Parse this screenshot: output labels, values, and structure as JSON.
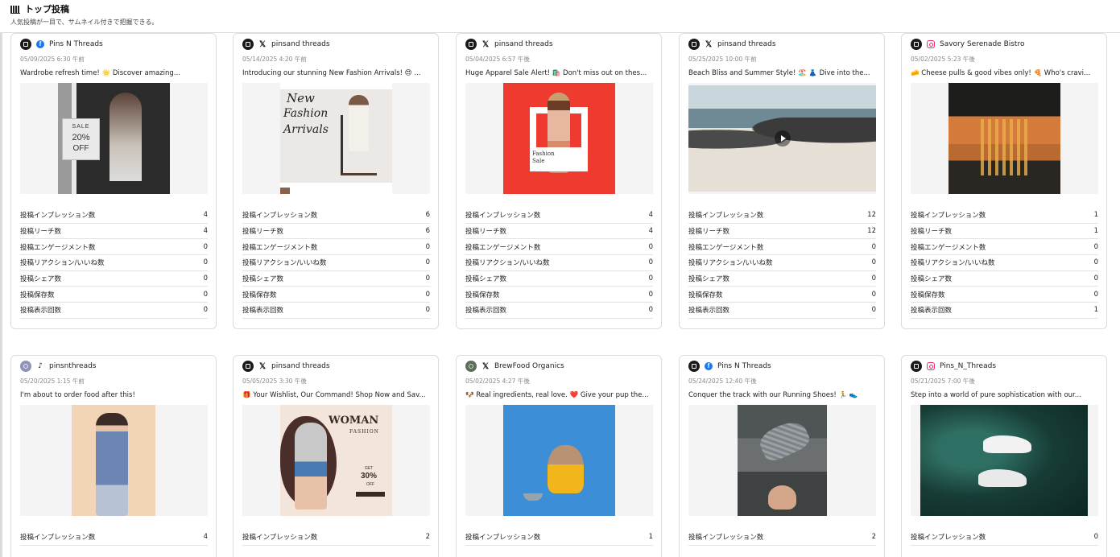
{
  "header": {
    "title": "トップ投稿",
    "subtitle": "人気投稿が一目で、サムネイル付きで把握できる。",
    "icon": "bar-chart-icon"
  },
  "metric_labels": [
    "投稿インプレッション数",
    "投稿リーチ数",
    "投稿エンゲージメント数",
    "投稿リアクション/いいね数",
    "投稿シェア数",
    "投稿保存数",
    "投稿表示回数"
  ],
  "posts": [
    {
      "account": "Pins N Threads",
      "network": "facebook",
      "date": "05/09/2025 6:30 午前",
      "text": "Wardrobe refresh time! 🌟 Discover amazing...",
      "metrics": [
        "4",
        "4",
        "0",
        "0",
        "0",
        "0",
        "0"
      ]
    },
    {
      "account": "pinsand threads",
      "network": "x",
      "date": "05/14/2025 4:20 午前",
      "text": "Introducing our stunning New Fashion Arrivals! 😍 ...",
      "metrics": [
        "6",
        "6",
        "0",
        "0",
        "0",
        "0",
        "0"
      ]
    },
    {
      "account": "pinsand threads",
      "network": "x",
      "date": "05/04/2025 6:57 午後",
      "text": "Huge Apparel Sale Alert! 🛍️ Don't miss out on thes...",
      "metrics": [
        "4",
        "4",
        "0",
        "0",
        "0",
        "0",
        "0"
      ]
    },
    {
      "account": "pinsand threads",
      "network": "x",
      "date": "05/25/2025 10:00 午前",
      "text": "Beach Bliss and Summer Style! 🏖️ 👗 Dive into the...",
      "metrics": [
        "12",
        "12",
        "0",
        "0",
        "0",
        "0",
        "0"
      ]
    },
    {
      "account": "Savory Serenade Bistro",
      "network": "instagram",
      "date": "05/02/2025 5:23 午後",
      "text": "🧀 Cheese pulls & good vibes only! 🍕 Who's cravi...",
      "metrics": [
        "1",
        "1",
        "0",
        "0",
        "0",
        "0",
        "1"
      ]
    },
    {
      "account": "pinsnthreads",
      "network": "tiktok",
      "date": "05/20/2025 1:15 午前",
      "text": "I'm about to order food after this!",
      "metrics": [
        "4"
      ]
    },
    {
      "account": "pinsand threads",
      "network": "x",
      "date": "05/05/2025 3:30 午後",
      "text": "🎁 Your Wishlist, Our Command! Shop Now and Sav...",
      "metrics": [
        "2"
      ]
    },
    {
      "account": "BrewFood Organics",
      "network": "x",
      "date": "05/02/2025 4:27 午後",
      "text": "🐶 Real ingredients, real love. ❤️ Give your pup the...",
      "metrics": [
        "1"
      ]
    },
    {
      "account": "Pins N Threads",
      "network": "facebook",
      "date": "05/24/2025 12:40 午後",
      "text": "Conquer the track with our Running Shoes! 🏃 👟",
      "metrics": [
        "2"
      ]
    },
    {
      "account": "Pins_N_Threads",
      "network": "instagram",
      "date": "05/21/2025 7:00 午後",
      "text": "Step into a world of pure sophistication with our...",
      "metrics": [
        "0"
      ]
    }
  ],
  "thumbnails": [
    {
      "desc": "sale",
      "sale_line1": "SALE",
      "sale_line2": "20%",
      "sale_line3": "OFF"
    },
    {
      "desc": "new-fashion",
      "line1": "New",
      "line2": "Fashion",
      "line3": "Arrivals"
    },
    {
      "desc": "fashion-sale",
      "line1": "Fashion",
      "line2": "Sale"
    },
    {
      "desc": "beach-video"
    },
    {
      "desc": "cheese-pizza"
    },
    {
      "desc": "pastel-model"
    },
    {
      "desc": "woman-fashion",
      "line1": "WOMAN",
      "line2": "FASHION",
      "line3": "GET",
      "line4": "30%",
      "line5": "OFF"
    },
    {
      "desc": "dog"
    },
    {
      "desc": "shoe-hand"
    },
    {
      "desc": "white-sneaker"
    }
  ]
}
